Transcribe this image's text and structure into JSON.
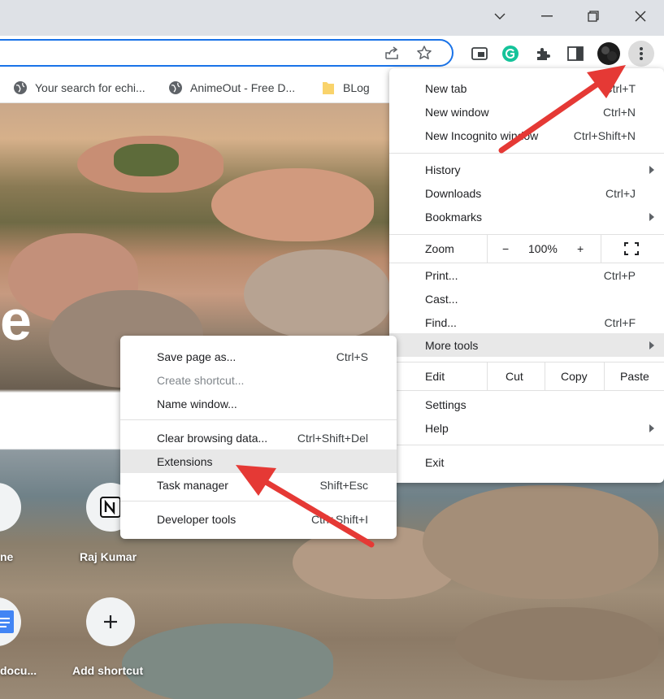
{
  "colors": {
    "accent": "#1a73e8",
    "arrow": "#e53935",
    "highlight": "#e8e8e8"
  },
  "bookmarks": [
    {
      "label": "Your search for echi...",
      "icon": "globe-icon"
    },
    {
      "label": "AnimeOut - Free D...",
      "icon": "globe-icon"
    },
    {
      "label": "BLog",
      "icon": "folder-icon"
    }
  ],
  "shortcuts": [
    {
      "label": "ne"
    },
    {
      "label": "Raj Kumar"
    },
    {
      "label": "docu..."
    },
    {
      "label": "Add shortcut"
    }
  ],
  "menu": {
    "new_tab": {
      "label": "New tab",
      "shortcut": "Ctrl+T"
    },
    "new_window": {
      "label": "New window",
      "shortcut": "Ctrl+N"
    },
    "new_incognito": {
      "label": "New Incognito window",
      "shortcut": "Ctrl+Shift+N"
    },
    "history": {
      "label": "History"
    },
    "downloads": {
      "label": "Downloads",
      "shortcut": "Ctrl+J"
    },
    "bookmarks": {
      "label": "Bookmarks"
    },
    "zoom": {
      "label": "Zoom",
      "minus": "−",
      "value": "100%",
      "plus": "+"
    },
    "print": {
      "label": "Print...",
      "shortcut": "Ctrl+P"
    },
    "cast": {
      "label": "Cast..."
    },
    "find": {
      "label": "Find...",
      "shortcut": "Ctrl+F"
    },
    "more_tools": {
      "label": "More tools"
    },
    "edit": {
      "label": "Edit",
      "cut": "Cut",
      "copy": "Copy",
      "paste": "Paste"
    },
    "settings": {
      "label": "Settings"
    },
    "help": {
      "label": "Help"
    },
    "exit": {
      "label": "Exit"
    }
  },
  "submenu": {
    "save_page": {
      "label": "Save page as...",
      "shortcut": "Ctrl+S"
    },
    "create_shortcut": {
      "label": "Create shortcut..."
    },
    "name_window": {
      "label": "Name window..."
    },
    "clear_browsing": {
      "label": "Clear browsing data...",
      "shortcut": "Ctrl+Shift+Del"
    },
    "extensions": {
      "label": "Extensions"
    },
    "task_manager": {
      "label": "Task manager",
      "shortcut": "Shift+Esc"
    },
    "developer_tools": {
      "label": "Developer tools",
      "shortcut": "Ctrl+Shift+I"
    }
  }
}
